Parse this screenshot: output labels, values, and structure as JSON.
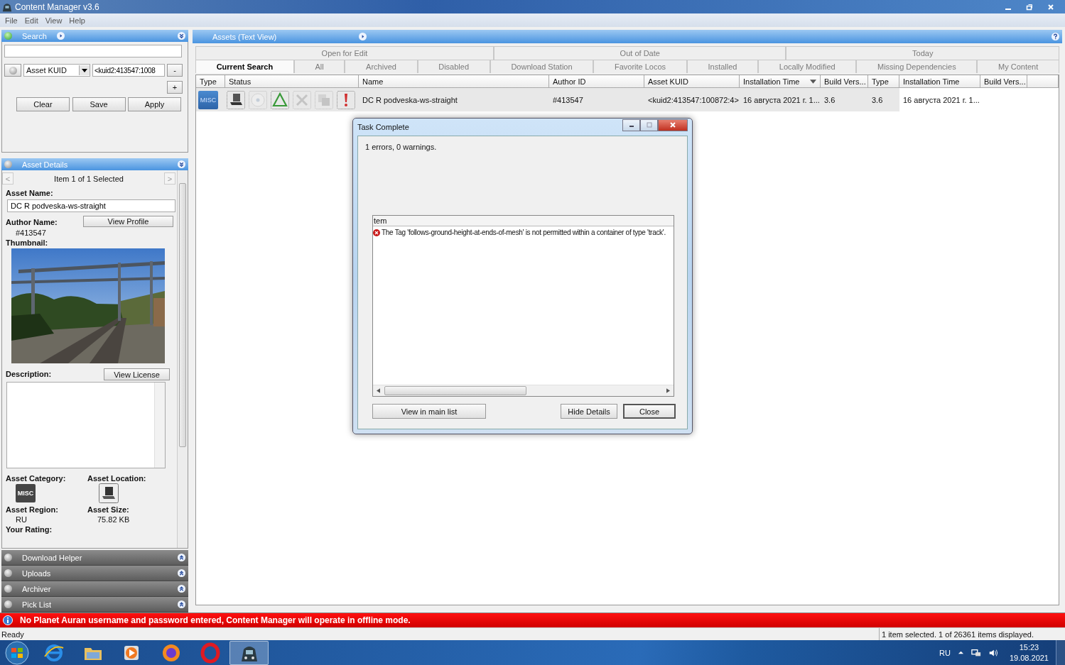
{
  "window": {
    "title": "Content Manager v3.6"
  },
  "menu": [
    "File",
    "Edit",
    "View",
    "Help"
  ],
  "search_panel": {
    "title": "Search",
    "active": true,
    "expanded": true,
    "filter_field": "Asset KUID",
    "filter_value": "<kuid2:413547:1008",
    "remove_button": "-",
    "add_button": "+",
    "buttons": [
      "Clear",
      "Save",
      "Apply"
    ]
  },
  "asset_details": {
    "title": "Asset Details",
    "active": false,
    "expanded": true,
    "navigator": "Item 1 of 1 Selected",
    "prev": "<",
    "next": ">",
    "asset_name_label": "Asset Name:",
    "asset_name": "DC R podveska-ws-straight",
    "author_label": "Author Name:",
    "author": "#413547",
    "view_profile": "View Profile",
    "thumbnail_label": "Thumbnail:",
    "description_label": "Description:",
    "view_license": "View License",
    "category_label": "Asset Category:",
    "category_badge": "MISC",
    "location_label": "Asset Location:",
    "region_label": "Asset Region:",
    "region": "RU",
    "size_label": "Asset Size:",
    "size": "75.82 KB",
    "rating_label": "Your Rating:"
  },
  "collapsed_panels": [
    {
      "title": "Download Helper",
      "expanded": false
    },
    {
      "title": "Uploads",
      "expanded": false
    },
    {
      "title": "Archiver",
      "expanded": false
    },
    {
      "title": "Pick List",
      "expanded": false
    }
  ],
  "assets_panel": {
    "title": "Assets (Text View)",
    "tabs_top": [
      {
        "label": "Open for Edit",
        "selected": false
      },
      {
        "label": "Out of Date",
        "selected": false
      },
      {
        "label": "Today",
        "selected": false
      }
    ],
    "tabs": [
      {
        "label": "Current Search",
        "selected": true
      },
      {
        "label": "All",
        "selected": false
      },
      {
        "label": "Archived",
        "selected": false
      },
      {
        "label": "Disabled",
        "selected": false
      },
      {
        "label": "Download Station",
        "selected": false
      },
      {
        "label": "Favorite Locos",
        "selected": false
      },
      {
        "label": "Installed",
        "selected": false
      },
      {
        "label": "Locally Modified",
        "selected": false
      },
      {
        "label": "Missing Dependencies",
        "selected": false
      },
      {
        "label": "My Content",
        "selected": false
      }
    ],
    "columns": [
      {
        "label": "Type",
        "sorted": false
      },
      {
        "label": "Status",
        "sorted": false
      },
      {
        "label": "Name",
        "sorted": false
      },
      {
        "label": "Author ID",
        "sorted": false
      },
      {
        "label": "Asset KUID",
        "sorted": false
      },
      {
        "label": "Installation Time",
        "sorted": true
      },
      {
        "label": "Build Vers...",
        "sorted": false
      },
      {
        "label": "Type",
        "sorted": false
      },
      {
        "label": "Installation Time",
        "sorted": false
      },
      {
        "label": "Build Vers...",
        "sorted": false
      }
    ],
    "rows": [
      {
        "selected": true,
        "status": [
          {
            "kind": "laptop",
            "on": true
          },
          {
            "kind": "disc",
            "on": false
          },
          {
            "kind": "triangle",
            "on": true
          },
          {
            "kind": "tools",
            "on": false
          },
          {
            "kind": "squares",
            "on": false
          },
          {
            "kind": "alert",
            "on": true
          }
        ],
        "cells": [
          "MISC",
          "",
          "DC R podveska-ws-straight",
          "#413547",
          "<kuid2:413547:100872:4>",
          "16 августа 2021 г. 1...",
          "3.6",
          "3.6",
          "16 августа 2021 г. 1..."
        ]
      }
    ]
  },
  "dialog": {
    "title": "Task Complete",
    "summary": "1 errors, 0 warnings.",
    "list_header": "tem",
    "messages": [
      {
        "kind": "error",
        "text": "The Tag 'follows-ground-height-at-ends-of-mesh' is not permitted within a container of type 'track'."
      }
    ],
    "buttons": [
      {
        "label": "View in main list",
        "default": false
      },
      {
        "label": "Hide Details",
        "default": false
      },
      {
        "label": "Close",
        "default": true
      }
    ]
  },
  "banner": "No Planet Auran username and password entered, Content Manager will operate in offline mode.",
  "status_bar": {
    "left": "Ready",
    "right": "1 item selected. 1 of 26361 items displayed."
  },
  "taskbar": {
    "apps": [
      {
        "kind": "ie",
        "selected": false
      },
      {
        "kind": "folder",
        "selected": false
      },
      {
        "kind": "media",
        "selected": false
      },
      {
        "kind": "firefox",
        "selected": false
      },
      {
        "kind": "opera",
        "selected": false
      },
      {
        "kind": "train",
        "selected": true
      }
    ],
    "language": "RU",
    "time": "15:23",
    "date": "19.08.2021"
  }
}
